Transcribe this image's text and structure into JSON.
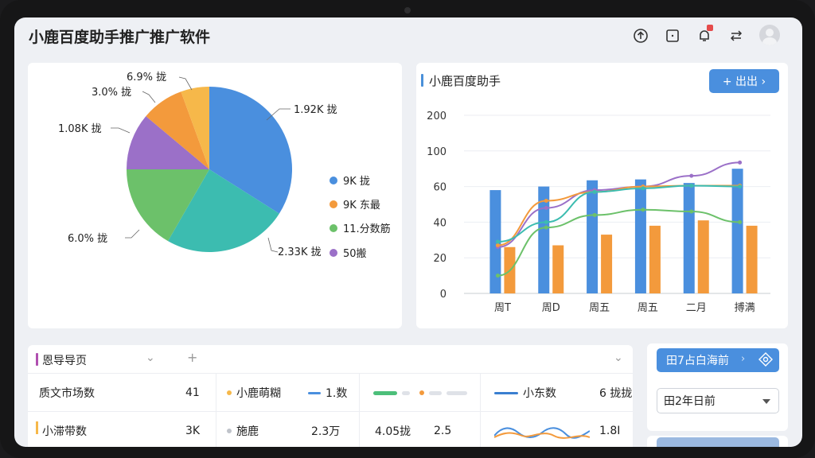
{
  "app": {
    "title": "小鹿百度助手推广推广软件"
  },
  "colors": {
    "blue": "#4a8fde",
    "orange": "#f39a3c",
    "green": "#6cc16a",
    "purple": "#9b70c8",
    "teal": "#3cbcb0",
    "yellow": "#f6b84a"
  },
  "toolbar_icons": [
    "upload-circle-icon",
    "square-frame-icon",
    "notification-bell-icon",
    "transfer-arrows-icon",
    "user-avatar-icon"
  ],
  "pie_card": {
    "labels": {
      "blue": "1.92K 拢",
      "teal": "2.33K 拢",
      "green": "6.0% 拢",
      "purple": "1.08K 拢",
      "orange": "3.0% 拢",
      "yellow": "6.9% 拢"
    },
    "legend": [
      "9K 拢",
      "9K 东最",
      "11.分数筋",
      "50搬"
    ]
  },
  "line_card": {
    "title": "小鹿百度助手",
    "export_label": "+ 出出 ›"
  },
  "chart_data": {
    "type": "bar",
    "categories": [
      "周T",
      "周D",
      "周五",
      "周五",
      "二月",
      "搏满"
    ],
    "ylim": [
      0,
      200
    ],
    "yticks": [
      "0",
      "20",
      "40",
      "60",
      "100",
      "200"
    ],
    "series": [
      {
        "values": [
          58,
          60,
          67,
          68,
          64,
          80
        ]
      },
      {
        "values": [
          26,
          27,
          33,
          38,
          41,
          38
        ]
      }
    ],
    "lines": [
      {
        "color": "purple",
        "values": [
          26,
          48,
          58,
          60,
          72,
          87
        ]
      },
      {
        "color": "orange",
        "values": [
          27,
          52,
          57,
          60,
          61,
          61
        ]
      },
      {
        "color": "teal",
        "values": [
          29,
          40,
          57,
          59,
          61,
          60
        ]
      },
      {
        "color": "green",
        "values": [
          10,
          37,
          44,
          47,
          46,
          40
        ]
      }
    ]
  },
  "table": {
    "title": "恩导导页",
    "ctrl_collapse": "⌄",
    "ctrl_add": "+",
    "rows": [
      {
        "name": "质文市场数",
        "value": "41",
        "legend1": "小鹿萌糊",
        "legend2": "1.数",
        "col5": "",
        "col6": "小东数",
        "col7": "6 拢拢"
      },
      {
        "name": "小滞带数",
        "value": "3K",
        "legend1": "施鹿",
        "legend2": "2.3万",
        "col5": "4.05拢",
        "col6": "2.5",
        "col7": "1.8I"
      }
    ]
  },
  "side": {
    "button_label": "田7占白海前",
    "select_value": "田2年日前"
  }
}
